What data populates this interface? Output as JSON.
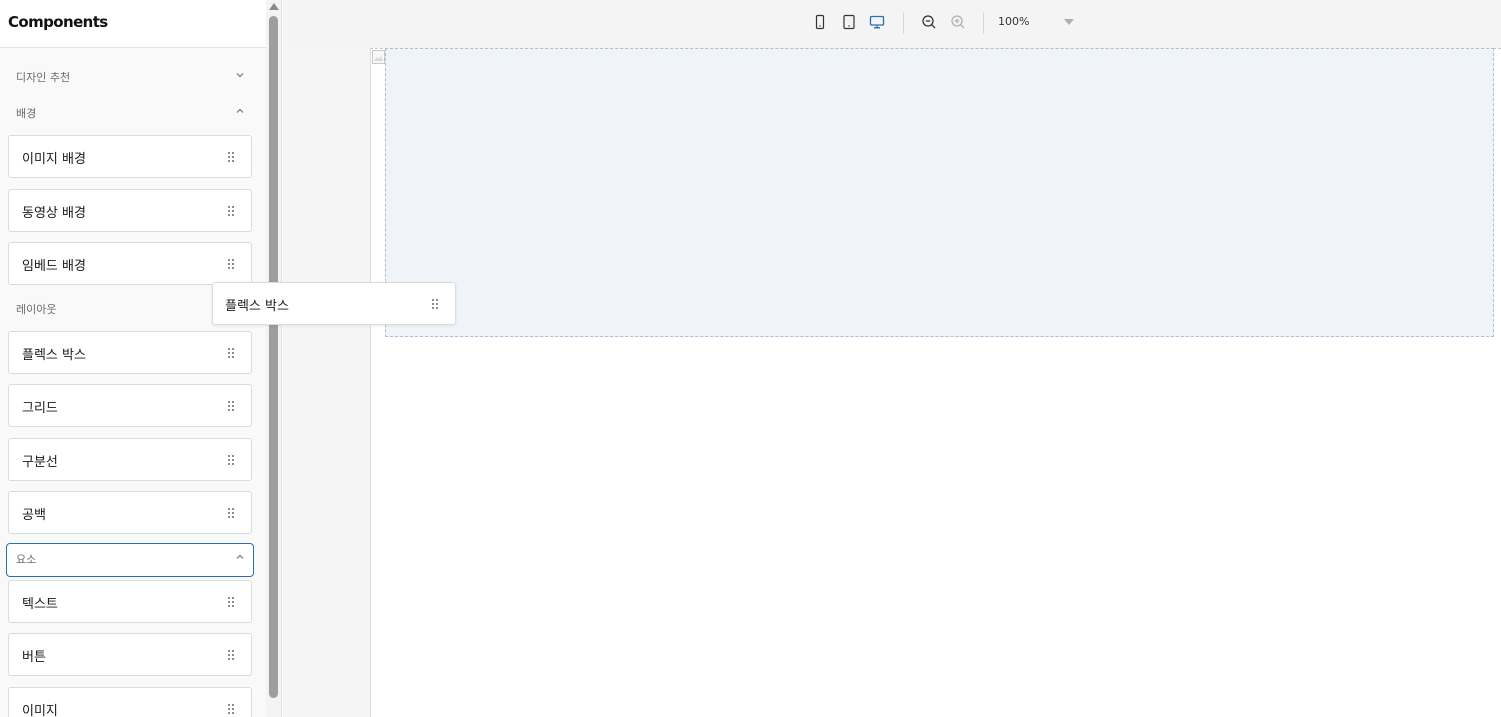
{
  "sidebar": {
    "title": "Components",
    "sections": {
      "design": {
        "label": "디자인 추천"
      },
      "background": {
        "label": "배경",
        "items": [
          "이미지 배경",
          "동영상 배경",
          "임베드 배경"
        ]
      },
      "layout": {
        "label": "레이아웃",
        "items": [
          "플렉스 박스",
          "그리드",
          "구분선",
          "공백"
        ]
      },
      "elements": {
        "label": "요소",
        "items": [
          "텍스트",
          "버튼",
          "이미지"
        ]
      }
    }
  },
  "toolbar": {
    "devices": [
      "mobile-icon",
      "tablet-icon",
      "desktop-icon"
    ],
    "active_device": "desktop",
    "zoom": "100%"
  },
  "drag_ghost": {
    "label": "플렉스 박스"
  },
  "colors": {
    "accent": "#2a6fb0",
    "drop_zone": "#f0f4f8",
    "drop_zone_border": "#a9c0d8"
  }
}
